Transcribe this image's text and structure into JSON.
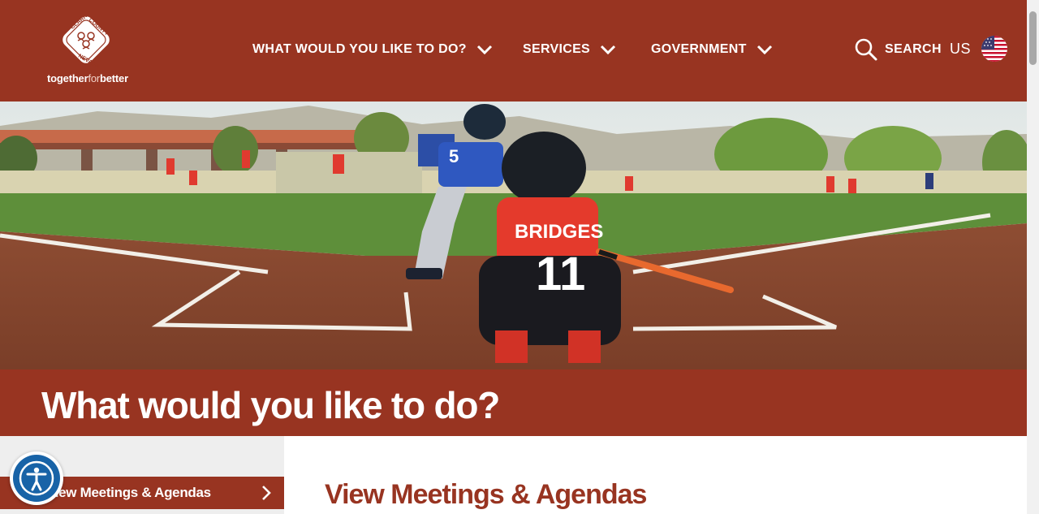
{
  "brand": {
    "badge_text": [
      "CLARK COUNTY",
      "NEVADA"
    ],
    "tagline_prefix": "together",
    "tagline_mid": "for",
    "tagline_suffix": "better"
  },
  "nav": {
    "items": [
      {
        "label": "WHAT WOULD YOU LIKE TO DO?",
        "icon": "chevron-down-icon"
      },
      {
        "label": "SERVICES",
        "icon": "chevron-down-icon"
      },
      {
        "label": "GOVERNMENT",
        "icon": "chevron-down-icon"
      }
    ],
    "search_label": "SEARCH",
    "language_label": "US",
    "flag_icon": "us-flag-icon"
  },
  "hero": {
    "image_name": "baseball-hero-image",
    "player_jersey": "BRIDGES",
    "player_number": "11",
    "pitcher_number": "5"
  },
  "page": {
    "title": "What would you like to do?"
  },
  "sidebar": {
    "active_item": {
      "label": "View Meetings & Agendas",
      "icon": "chevron-right-icon"
    }
  },
  "main": {
    "heading": "View Meetings & Agendas"
  },
  "accessibility": {
    "icon": "accessibility-icon"
  },
  "colors": {
    "brand": "#983421",
    "accessibility_blue": "#1863a7",
    "sidebar_bg": "#eeeeee"
  }
}
